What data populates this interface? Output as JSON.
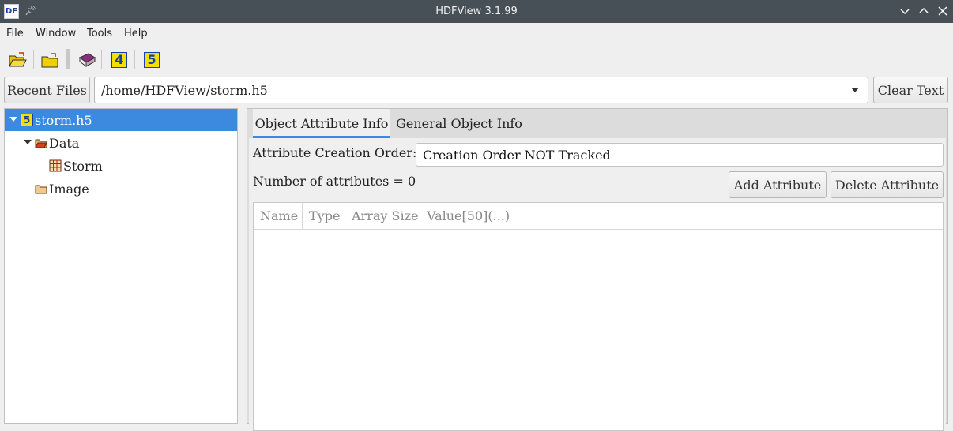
{
  "window": {
    "title": "HDFView 3.1.99",
    "app_icon_text": "DF"
  },
  "menu": [
    "File",
    "Window",
    "Tools",
    "Help"
  ],
  "toolbar": {
    "icons": [
      "open-file-icon",
      "open-folder-icon",
      "help-book-icon",
      "hdf4-icon",
      "hdf5-icon"
    ],
    "hdf4_label": "4",
    "hdf5_label": "5"
  },
  "path_bar": {
    "recent_label": "Recent Files",
    "path_value": "/home/HDFView/storm.h5",
    "clear_label": "Clear Text"
  },
  "tree": {
    "root": {
      "label": "storm.h5",
      "icon_text": "5"
    },
    "data_group": "Data",
    "storm_dataset": "Storm",
    "image_group": "Image"
  },
  "tabs": {
    "attr_info": "Object Attribute Info",
    "general_info": "General Object Info"
  },
  "attributes": {
    "creation_order_label": "Attribute Creation Order:",
    "creation_order_value": "Creation Order NOT Tracked",
    "count_text": "Number of attributes = 0",
    "add_label": "Add Attribute",
    "delete_label": "Delete Attribute",
    "columns": [
      "Name",
      "Type",
      "Array Size",
      "Value[50](...)"
    ]
  },
  "colors": {
    "titlebar": "#475057",
    "selection": "#3b8ae0",
    "hdf_yellow": "#f2e000",
    "hdf_blue": "#1a3fa0"
  }
}
